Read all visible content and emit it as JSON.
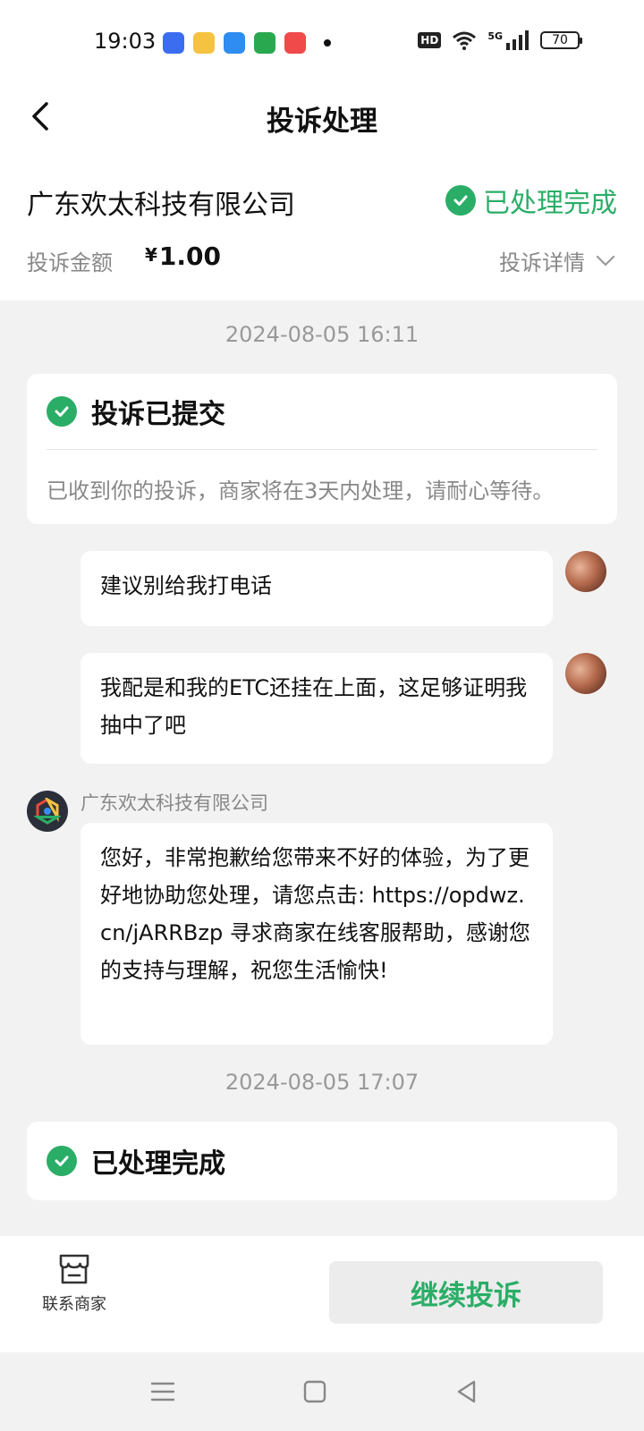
{
  "status_bar": {
    "time": "19:03",
    "hd": "HD",
    "network": "5G",
    "battery": "70",
    "app_icons": [
      {
        "icon": "baidu-app-icon",
        "color": "#3a6df0"
      },
      {
        "icon": "notes-app-icon",
        "color": "#f5c242"
      },
      {
        "icon": "blue-app-icon",
        "color": "#2f8cf0"
      },
      {
        "icon": "security-app-icon",
        "color": "#2aa84f"
      },
      {
        "icon": "music-app-icon",
        "color": "#f04a4a"
      }
    ]
  },
  "header": {
    "title": "投诉处理",
    "back_icon": "back-arrow-icon"
  },
  "merchant": {
    "name": "广东欢太科技有限公司",
    "status": "已处理完成",
    "amount_label": "投诉金额",
    "amount_currency": "¥",
    "amount_value": "1.00",
    "detail_label": "投诉详情"
  },
  "timeline": {
    "time1": "2024-08-05 16:11",
    "submitted_card": {
      "title": "投诉已提交",
      "body": "已收到你的投诉，商家将在3天内处理，请耐心等待。"
    },
    "user_messages": [
      {
        "text": "建议别给我打电话"
      },
      {
        "text": "我配是和我的ETC还挂在上面，这足够证明我抽中了吧"
      }
    ],
    "merchant_message": {
      "sender": "广东欢太科技有限公司",
      "text": "您好，非常抱歉给您带来不好的体验，为了更好地协助您处理，请您点击: https://opdwz.cn/jARRBzp 寻求商家在线客服帮助，感谢您的支持与理解，祝您生活愉快!"
    },
    "time2": "2024-08-05 17:07",
    "completed_card": {
      "title": "已处理完成"
    }
  },
  "bottom_bar": {
    "contact_label": "联系商家",
    "continue_label": "继续投诉"
  },
  "colors": {
    "accent": "#2aae67",
    "background": "#f2f2f2",
    "card": "#ffffff"
  }
}
